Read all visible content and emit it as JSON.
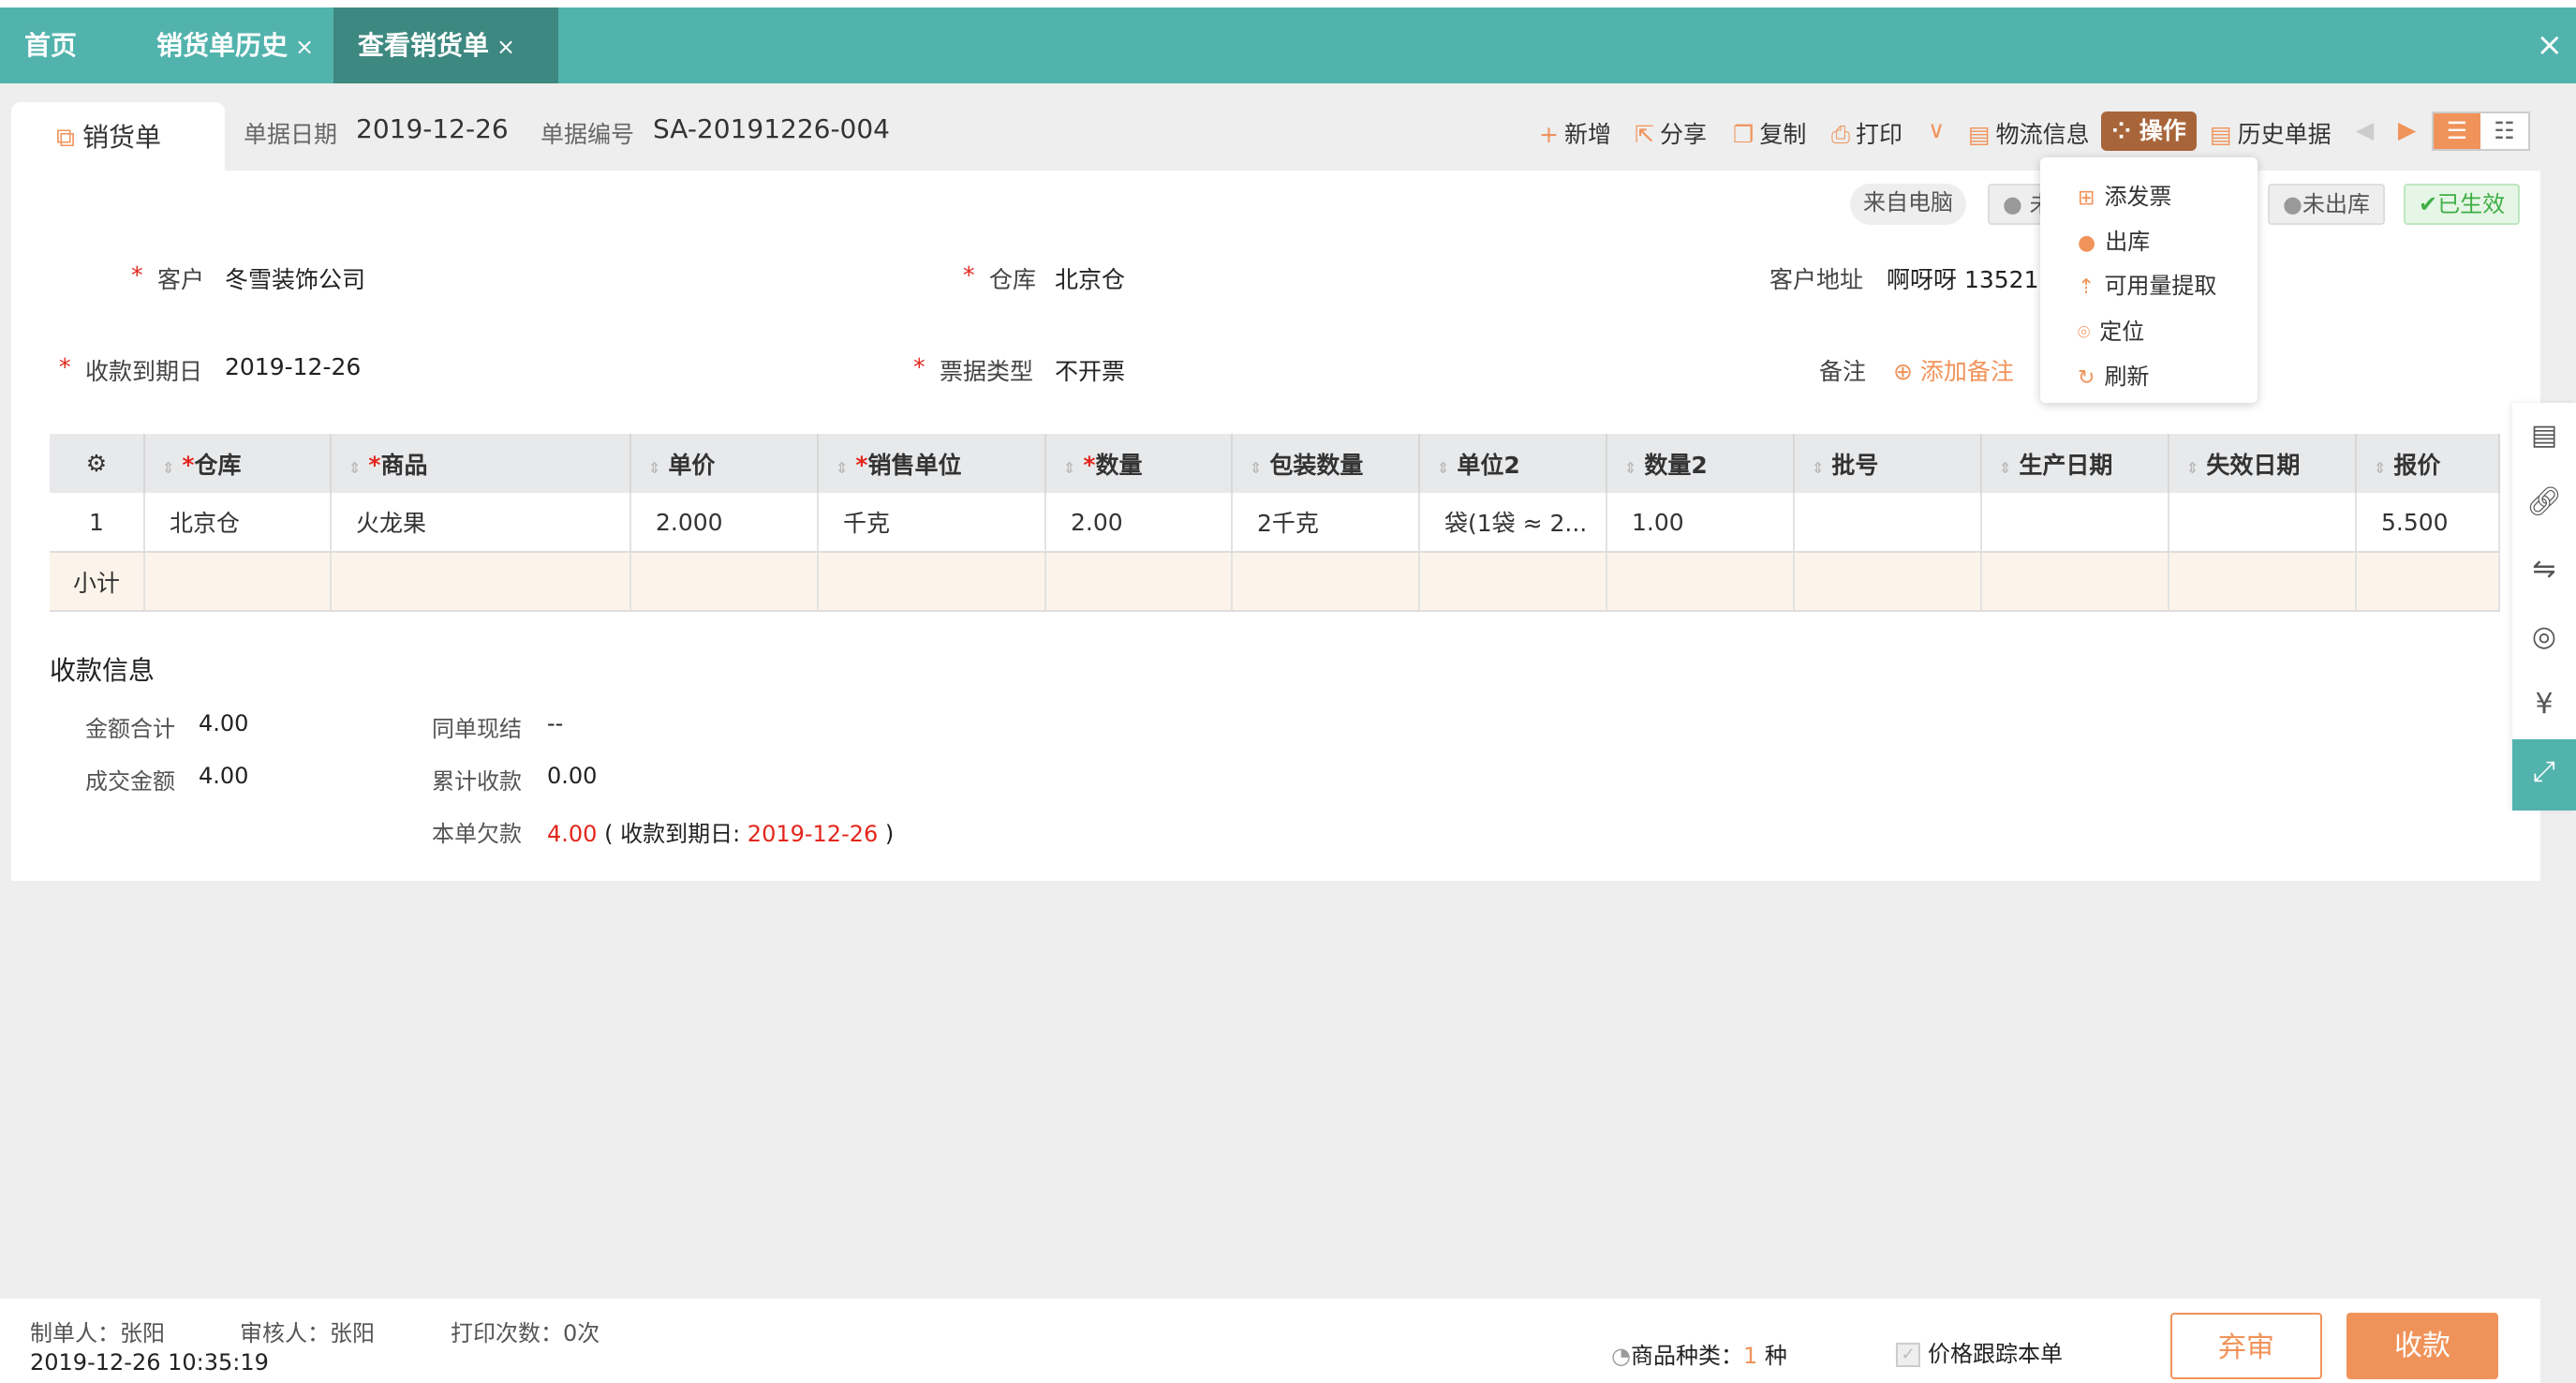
{
  "tabs": [
    {
      "label": "首页"
    },
    {
      "label": "销货单历史",
      "close": "×"
    },
    {
      "label": "查看销货单",
      "close": "×"
    }
  ],
  "window_close": "×",
  "doc": {
    "tab_label": "销货单",
    "date_label": "单据日期",
    "date": "2019-12-26",
    "no_label": "单据编号",
    "no": "SA-20191226-004"
  },
  "toolbar": {
    "new": "新增",
    "share": "分享",
    "copy": "复制",
    "print": "打印",
    "logistics": "物流信息",
    "operate": "操作",
    "history": "历史单据"
  },
  "badges": {
    "source": "来自电脑",
    "unaudit": "未",
    "unshipped": "未出库",
    "effective": "已生效"
  },
  "fields": {
    "customer_label": "客户",
    "customer": "冬雪装饰公司",
    "warehouse_label": "仓库",
    "warehouse": "北京仓",
    "address_label": "客户地址",
    "address": "啊呀呀 1352157",
    "due_label": "收款到期日",
    "due": "2019-12-26",
    "invoice_label": "票据类型",
    "invoice": "不开票",
    "remark_label": "备注",
    "remark_add": "添加备注"
  },
  "dropdown": [
    "添发票",
    "出库",
    "可用量提取",
    "定位",
    "刷新"
  ],
  "table": {
    "headers": [
      "仓库",
      "商品",
      "单价",
      "销售单位",
      "数量",
      "包装数量",
      "单位2",
      "数量2",
      "批号",
      "生产日期",
      "失效日期",
      "报价"
    ],
    "required": [
      true,
      true,
      false,
      true,
      true,
      false,
      false,
      false,
      false,
      false,
      false,
      false
    ],
    "rows": [
      [
        "1",
        "北京仓",
        "火龙果",
        "2.000",
        "千克",
        "2.00",
        "2千克",
        "袋(1袋 ≈ 2...",
        "1.00",
        "",
        "",
        "",
        "5.500"
      ]
    ],
    "subtotal_label": "小计"
  },
  "payment": {
    "title": "收款信息",
    "total_label": "金额合计",
    "total": "4.00",
    "deal_label": "成交金额",
    "deal": "4.00",
    "cash_label": "同单现结",
    "cash": "--",
    "acc_label": "累计收款",
    "acc": "0.00",
    "owe_label": "本单欠款",
    "owe": "4.00",
    "due_prefix": "( 收款到期日:",
    "due": "2019-12-26",
    "due_suffix": ")"
  },
  "footer": {
    "maker": "制单人：张阳",
    "auditor": "审核人：张阳",
    "prints": "打印次数：0次",
    "time": "2019-12-26 10:35:19",
    "kinds_label": "商品种类：",
    "kinds": "1",
    "kinds_unit": "种",
    "track": "价格跟踪本单",
    "reject": "弃审",
    "collect": "收款"
  },
  "colors": {
    "teal": "#52b3ad",
    "orange": "#f0935a",
    "operate": "#a8653a",
    "red": "#e3261c"
  }
}
